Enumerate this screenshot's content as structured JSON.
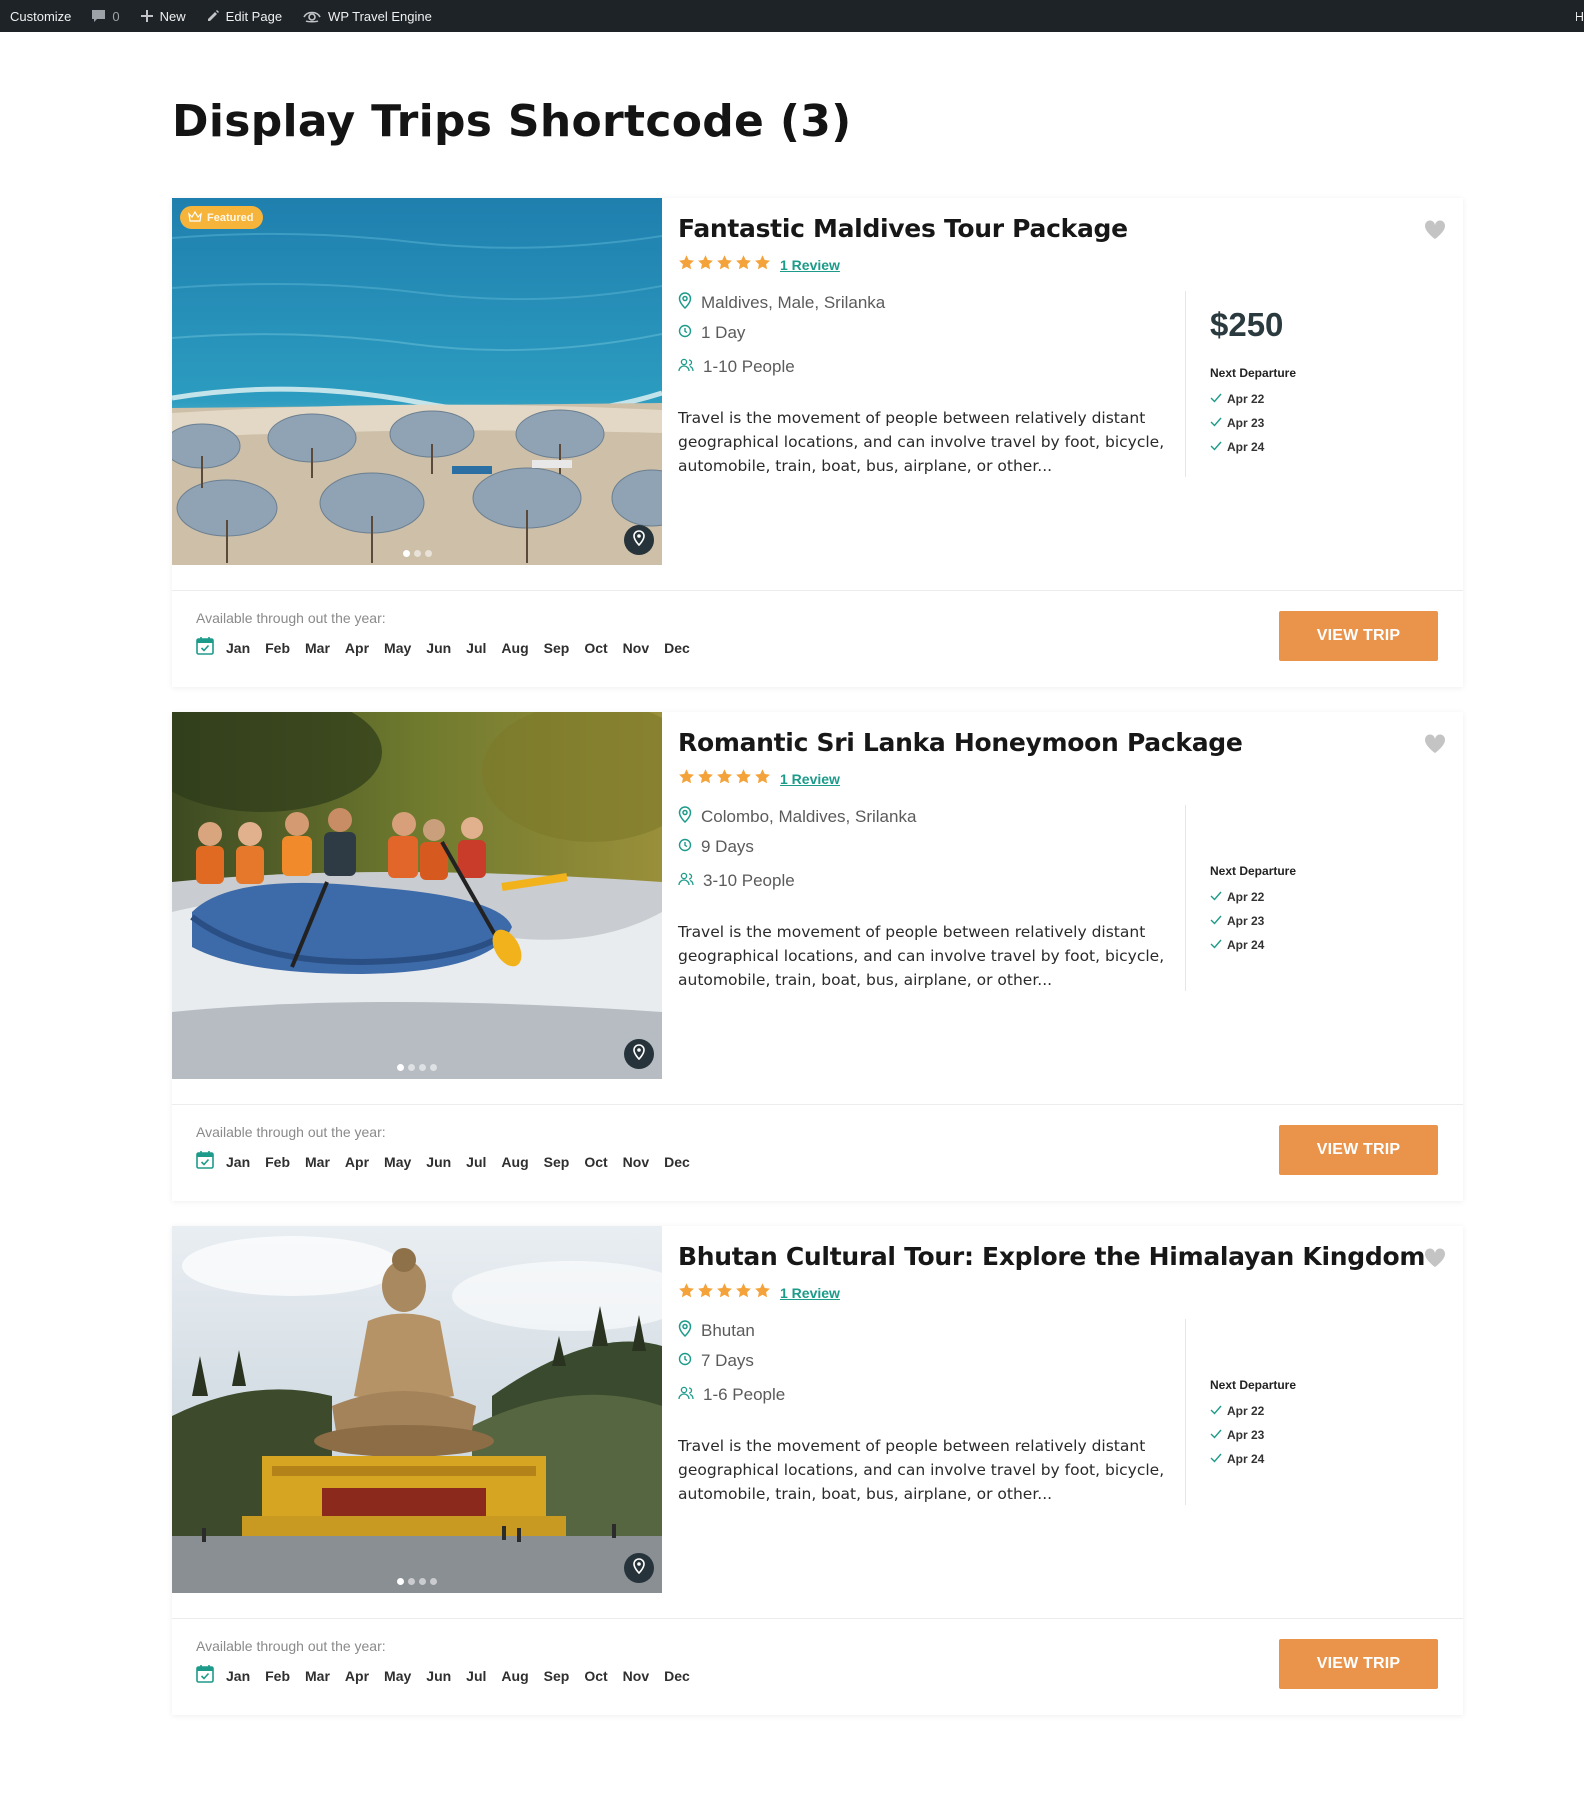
{
  "admin_bar": {
    "customize": "Customize",
    "comments_count": "0",
    "new": "New",
    "edit_page": "Edit Page",
    "plugin": "WP Travel Engine",
    "right_initial": "H"
  },
  "page": {
    "title": "Display Trips Shortcode (3)"
  },
  "colors": {
    "accent_teal": "#1d9b8a",
    "button_orange": "#e9934b",
    "star_orange": "#f4a23a",
    "admin_bar_bg": "#1d2327"
  },
  "trips": [
    {
      "featured_label": "Featured",
      "title": "Fantastic Maldives Tour Package",
      "review": "1 Review",
      "rating": 5,
      "location": "Maldives, Male, Srilanka",
      "duration": "1 Day",
      "people": "1-10 People",
      "description": "Travel is the movement of people between relatively distant geographical locations, and can involve travel by foot, bicycle, automobile, train, boat, bus, airplane, or other...",
      "price": "$250",
      "next_departure_label": "Next Departure",
      "departures": [
        "Apr 22",
        "Apr 23",
        "Apr 24"
      ],
      "available_label": "Available through out the year:",
      "months": [
        "Jan",
        "Feb",
        "Mar",
        "Apr",
        "May",
        "Jun",
        "Jul",
        "Aug",
        "Sep",
        "Oct",
        "Nov",
        "Dec"
      ],
      "button": "VIEW TRIP",
      "slides": 3,
      "active_slide": 1
    },
    {
      "featured_label": "",
      "title": "Romantic Sri Lanka Honeymoon Package",
      "review": "1 Review",
      "rating": 5,
      "location": "Colombo, Maldives, Srilanka",
      "duration": "9 Days",
      "people": "3-10 People",
      "description": "Travel is the movement of people between relatively distant geographical locations, and can involve travel by foot, bicycle, automobile, train, boat, bus, airplane, or other...",
      "price": "",
      "next_departure_label": "Next Departure",
      "departures": [
        "Apr 22",
        "Apr 23",
        "Apr 24"
      ],
      "available_label": "Available through out the year:",
      "months": [
        "Jan",
        "Feb",
        "Mar",
        "Apr",
        "May",
        "Jun",
        "Jul",
        "Aug",
        "Sep",
        "Oct",
        "Nov",
        "Dec"
      ],
      "button": "VIEW TRIP",
      "slides": 4,
      "active_slide": 1
    },
    {
      "featured_label": "",
      "title": "Bhutan Cultural Tour: Explore the Himalayan Kingdom",
      "review": "1 Review",
      "rating": 5,
      "location": "Bhutan",
      "duration": "7 Days",
      "people": "1-6 People",
      "description": "Travel is the movement of people between relatively distant geographical locations, and can involve travel by foot, bicycle, automobile, train, boat, bus, airplane, or other...",
      "price": "",
      "next_departure_label": "Next Departure",
      "departures": [
        "Apr 22",
        "Apr 23",
        "Apr 24"
      ],
      "available_label": "Available through out the year:",
      "months": [
        "Jan",
        "Feb",
        "Mar",
        "Apr",
        "May",
        "Jun",
        "Jul",
        "Aug",
        "Sep",
        "Oct",
        "Nov",
        "Dec"
      ],
      "button": "VIEW TRIP",
      "slides": 4,
      "active_slide": 1
    }
  ]
}
